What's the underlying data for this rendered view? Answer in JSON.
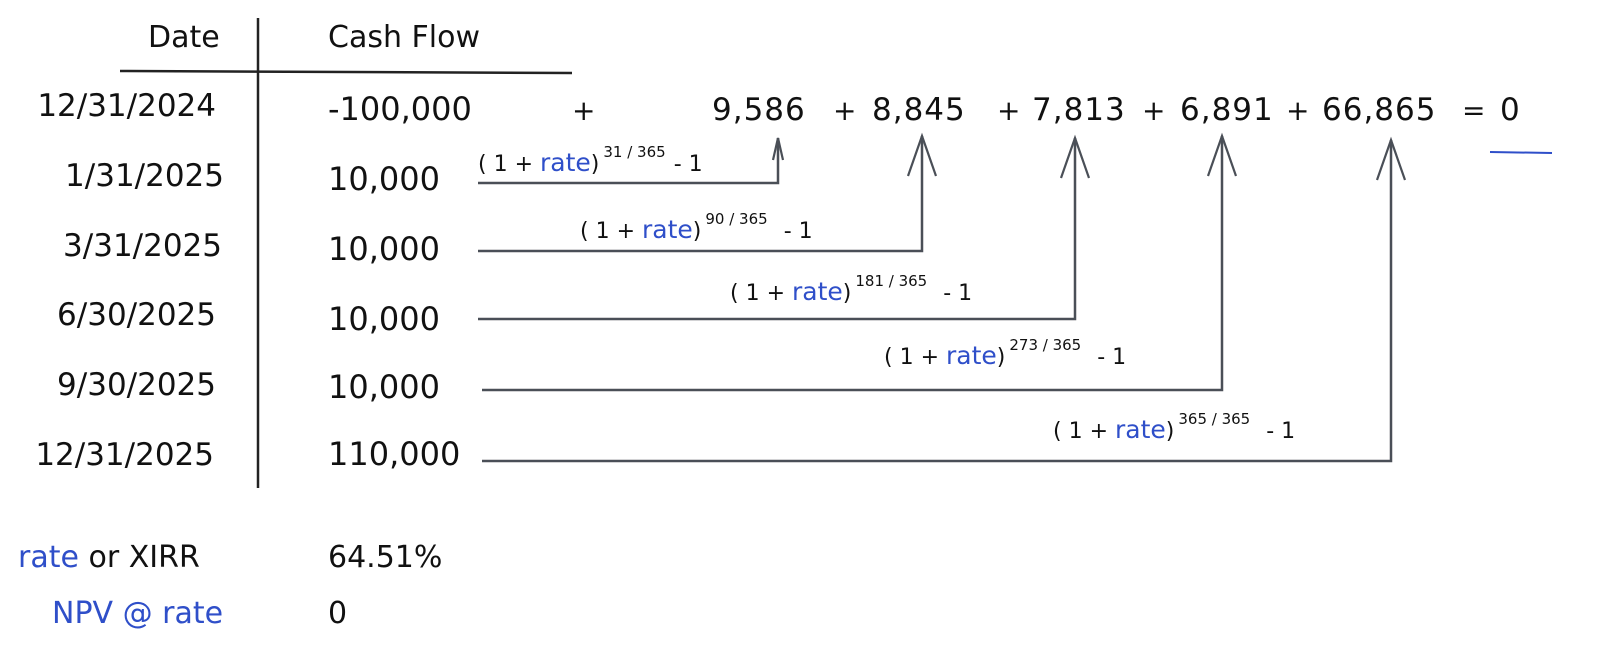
{
  "table": {
    "headers": {
      "date": "Date",
      "cash_flow": "Cash Flow"
    },
    "rows": [
      {
        "date": "12/31/2024",
        "cash_flow": "-100,000"
      },
      {
        "date": "1/31/2025",
        "cash_flow": "10,000"
      },
      {
        "date": "3/31/2025",
        "cash_flow": "10,000"
      },
      {
        "date": "6/30/2025",
        "cash_flow": "10,000"
      },
      {
        "date": "9/30/2025",
        "cash_flow": "10,000"
      },
      {
        "date": "12/31/2025",
        "cash_flow": "110,000"
      }
    ]
  },
  "equation": {
    "lead_plus": "+",
    "terms": [
      "9,586",
      "8,845",
      "7,813",
      "6,891",
      "66,865"
    ],
    "plus": "+",
    "equals": "=",
    "result": "0"
  },
  "discount_formulas": [
    {
      "open": "( 1 +",
      "rate": "rate",
      "close": ")",
      "exponent": "31 / 365",
      "minus": "- 1"
    },
    {
      "open": "( 1 +",
      "rate": "rate",
      "close": ")",
      "exponent": "90 / 365",
      "minus": "- 1"
    },
    {
      "open": "( 1 +",
      "rate": "rate",
      "close": ")",
      "exponent": "181 / 365",
      "minus": "- 1"
    },
    {
      "open": "( 1 +",
      "rate": "rate",
      "close": ")",
      "exponent": "273 / 365",
      "minus": "- 1"
    },
    {
      "open": "( 1 +",
      "rate": "rate",
      "close": ")",
      "exponent": "365 / 365",
      "minus": "- 1"
    }
  ],
  "summary": {
    "rate_label_blue": "rate",
    "rate_label_rest": "or XIRR",
    "rate_value": "64.51%",
    "npv_label": "NPV @ rate",
    "npv_value": "0"
  },
  "colors": {
    "ink": "#111111",
    "accent_blue": "#2f4fc9",
    "arrow_gray": "#4a4f57"
  }
}
